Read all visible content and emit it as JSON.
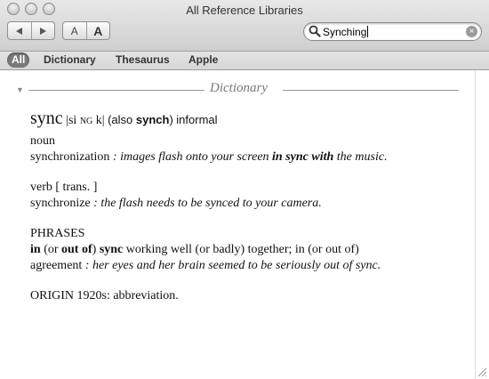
{
  "window": {
    "title": "All Reference Libraries",
    "nav": {
      "back_icon": "triangle-left",
      "forward_icon": "triangle-right"
    },
    "font_size": {
      "smaller": "A",
      "larger": "A"
    }
  },
  "search": {
    "value": "Synching",
    "clear_icon": "x-circle"
  },
  "scope": {
    "items": [
      "All",
      "Dictionary",
      "Thesaurus",
      "Apple"
    ],
    "selected": "All"
  },
  "section": {
    "title": "Dictionary"
  },
  "entry": {
    "headword": "sync",
    "pron_open": "|si",
    "pron_ng": "NG",
    "pron_close": " k|",
    "also_open": "(also ",
    "also_word": "synch",
    "also_close": ")",
    "register": "informal",
    "pos_noun": "noun",
    "noun_def": "synchronization",
    "noun_ex_pre": " : images flash onto your screen ",
    "noun_ex_bold": "in sync with",
    "noun_ex_post": " the music.",
    "pos_verb": "verb [ trans. ]",
    "verb_def": "synchronize",
    "verb_ex": " : the flash needs to be synced to your camera.",
    "phrases_label": "PHRASES",
    "phr_in": "in",
    "phr_or": " (or ",
    "phr_outof": "out of",
    "phr_close": ") ",
    "phr_sync": "sync",
    "phr_rest": " working well (or badly) together; in (or out of)",
    "phr_def2": "agreement",
    "phr_ex": " : her eyes and her brain seemed to be seriously out of sync.",
    "origin": "ORIGIN 1920s: abbreviation."
  }
}
